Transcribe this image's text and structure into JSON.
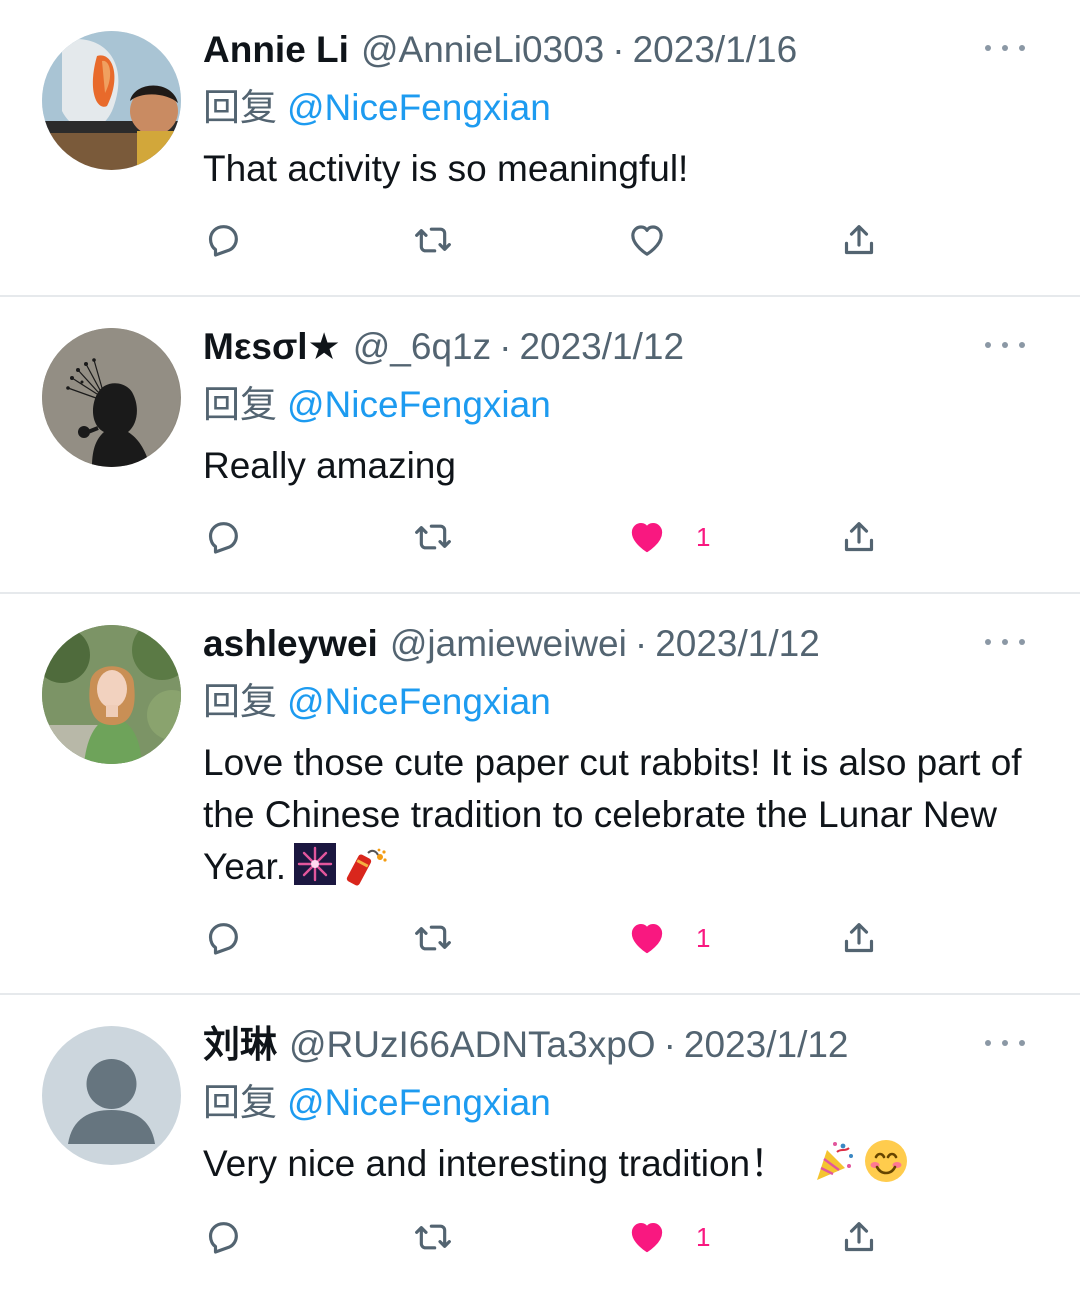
{
  "tweets": [
    {
      "name": "Annie Li",
      "handle": "@AnnieLi0303",
      "separator": "·",
      "date": "2023/1/16",
      "reply_prefix": "回复",
      "reply_to": "@NiceFengxian",
      "text": "That activity is so meaningful!",
      "like_count": "",
      "liked": false,
      "avatar": "photo-child-goldfish"
    },
    {
      "name": "Mεsσl★",
      "handle": "@_6q1z",
      "separator": "·",
      "date": "2023/1/12",
      "reply_prefix": "回复",
      "reply_to": "@NiceFengxian",
      "text": "Really amazing",
      "like_count": "1",
      "liked": true,
      "avatar": "silhouette-woman"
    },
    {
      "name": "ashleywei",
      "handle": "@jamieweiwei",
      "separator": "·",
      "date": "2023/1/12",
      "reply_prefix": "回复",
      "reply_to": "@NiceFengxian",
      "text": "Love those cute paper cut rabbits! It is also part of the Chinese tradition to celebrate the Lunar New Year.",
      "like_count": "1",
      "liked": true,
      "avatar": "photo-woman-green-dress"
    },
    {
      "name": "刘琳",
      "handle": "@RUzI66ADNTa3xpO",
      "separator": "·",
      "date": "2023/1/12",
      "reply_prefix": "回复",
      "reply_to": "@NiceFengxian",
      "text": "Very nice and interesting tradition！",
      "like_count": "1",
      "liked": true,
      "avatar": "default-avatar"
    }
  ],
  "icons": {
    "reply": "reply-icon",
    "retweet": "retweet-icon",
    "like": "heart-icon",
    "share": "share-icon",
    "more": "more-icon"
  },
  "colors": {
    "link": "#1d9bf0",
    "secondary_text": "#536471",
    "like": "#f91880",
    "icon": "#536471",
    "divider": "#e6e9ec"
  }
}
